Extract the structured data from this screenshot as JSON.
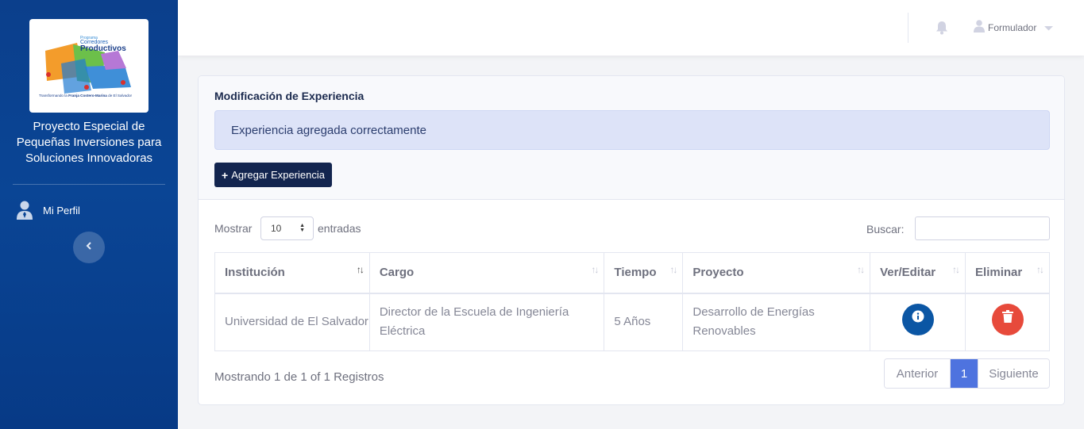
{
  "sidebar": {
    "logo": {
      "program_small": "Programa",
      "program_title_1": "Corredores",
      "program_title_2": "Productivos",
      "tagline_pre": "Transformando la ",
      "tagline_bold": "Franja Costero-Marina",
      "tagline_post": " de El Salvador"
    },
    "brand_lines": [
      "Proyecto Especial de",
      "Pequeñas Inversiones para",
      "Soluciones Innovadoras"
    ],
    "nav": [
      {
        "label": "Mi Perfil",
        "icon": "user-tie-icon"
      }
    ],
    "toggle_icon": "chevron-left-icon"
  },
  "topbar": {
    "notification_icon": "bell-icon",
    "user_name": "Formulador",
    "user_icon": "user-icon",
    "caret_icon": "caret-down-icon"
  },
  "card": {
    "title": "Modificación de Experiencia",
    "alert": "Experiencia agregada correctamente",
    "add_button": "Agregar Experiencia",
    "add_button_icon": "plus-icon"
  },
  "table_controls": {
    "show_label": "Mostrar",
    "page_size": "10",
    "entries_label": "entradas",
    "search_label": "Buscar:",
    "search_value": ""
  },
  "table": {
    "columns": [
      "Institución",
      "Cargo",
      "Tiempo",
      "Proyecto",
      "Ver/Editar",
      "Eliminar"
    ],
    "rows": [
      {
        "institucion": "Universidad de El Salvador",
        "cargo": "Director de la Escuela de Ingeniería Eléctrica",
        "tiempo": "5 Años",
        "proyecto": "Desarrollo de Energías Renovables",
        "view_icon": "info-icon",
        "delete_icon": "trash-icon"
      }
    ]
  },
  "footer": {
    "info": "Mostrando 1 de 1 of 1 Registros",
    "prev": "Anterior",
    "current_page": "1",
    "next": "Siguiente"
  },
  "colors": {
    "sidebar": "#0a4595",
    "primary_dark": "#13254f",
    "page_active": "#4e73df",
    "info_button": "#0b56a4",
    "danger_button": "#e74a3b",
    "alert_bg": "#dde3f8"
  }
}
